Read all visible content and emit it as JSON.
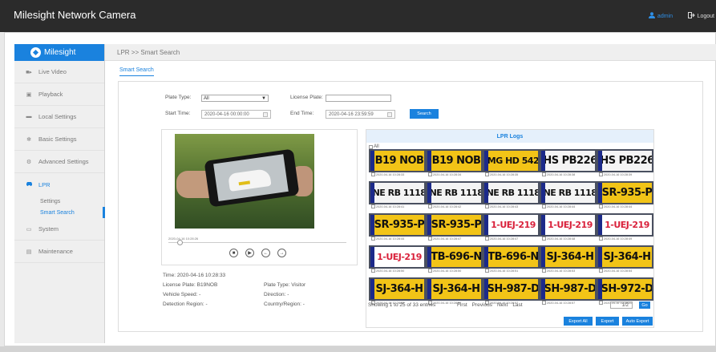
{
  "header": {
    "title": "Milesight Network Camera",
    "user": "admin",
    "logout": "Logout"
  },
  "sidebar": {
    "brand": "Milesight",
    "items": [
      {
        "label": "Live Video",
        "icon": "video-camera-icon"
      },
      {
        "label": "Playback",
        "icon": "playback-icon"
      },
      {
        "label": "Local Settings",
        "icon": "folder-icon"
      },
      {
        "label": "Basic Settings",
        "icon": "gear-icon"
      },
      {
        "label": "Advanced Settings",
        "icon": "advanced-gears-icon"
      },
      {
        "label": "LPR",
        "icon": "car-icon"
      },
      {
        "label": "System",
        "icon": "monitor-icon"
      },
      {
        "label": "Maintenance",
        "icon": "toolbox-icon"
      }
    ],
    "lpr_sub": [
      "Settings",
      "Smart Search"
    ]
  },
  "breadcrumb": "LPR >> Smart Search",
  "tab": "Smart Search",
  "search": {
    "plate_type_label": "Plate Type:",
    "plate_type_value": "All",
    "license_plate_label": "License Plate:",
    "license_plate_value": "",
    "start_time_label": "Start Time:",
    "start_time_value": "2020-04-16 00:00:00",
    "end_time_label": "End Time:",
    "end_time_value": "2020-04-16 23:59:59",
    "search_button": "Search"
  },
  "player": {
    "timestamp": "2020-04-16 10:28:26"
  },
  "details": {
    "time": "Time: 2020-04-16 10:28:33",
    "license_plate": "License Plate: B19NOB",
    "plate_type": "Plate Type: Visitor",
    "vehicle_speed": "Vehicle Speed: -",
    "direction": "Direction: -",
    "detection_region": "Detection Region: -",
    "country_region": "Country/Region: -"
  },
  "logs": {
    "title": "LPR Logs",
    "all_label": "All",
    "entries": [
      {
        "plate": "B19 NOB",
        "time": "2020-04-16 10:28:33",
        "style": "yellow"
      },
      {
        "plate": "B19 NOB",
        "time": "2020-04-16 10:28:34",
        "style": "yellow"
      },
      {
        "plate": "MG HD 542",
        "time": "2020-04-16 10:28:35",
        "style": "yellow"
      },
      {
        "plate": "HS PB226",
        "time": "2020-04-16 10:28:38",
        "style": "white"
      },
      {
        "plate": "HS PB226",
        "time": "2020-04-16 10:28:39",
        "style": "white"
      },
      {
        "plate": "NE RB 1118",
        "time": "2020-04-16 10:28:41",
        "style": "white"
      },
      {
        "plate": "NE RB 1118",
        "time": "2020-04-16 10:28:42",
        "style": "white"
      },
      {
        "plate": "NE RB 1118",
        "time": "2020-04-16 10:28:43",
        "style": "white"
      },
      {
        "plate": "NE RB 1118",
        "time": "2020-04-16 10:28:44",
        "style": "white"
      },
      {
        "plate": "SR-935-P",
        "time": "2020-04-16 10:28:44",
        "style": "yellow"
      },
      {
        "plate": "SR-935-P",
        "time": "2020-04-16 10:28:44",
        "style": "yellow"
      },
      {
        "plate": "SR-935-P",
        "time": "2020-04-16 10:28:47",
        "style": "yellow"
      },
      {
        "plate": "1-UEJ-219",
        "time": "2020-04-16 10:28:47",
        "style": "red"
      },
      {
        "plate": "1-UEJ-219",
        "time": "2020-04-16 10:28:48",
        "style": "red"
      },
      {
        "plate": "1-UEJ-219",
        "time": "2020-04-16 10:28:49",
        "style": "red"
      },
      {
        "plate": "1-UEJ-219",
        "time": "2020-04-16 10:28:50",
        "style": "red"
      },
      {
        "plate": "TB-696-N",
        "time": "2020-04-16 10:28:50",
        "style": "yellow"
      },
      {
        "plate": "TB-696-N",
        "time": "2020-04-16 10:28:51",
        "style": "yellow"
      },
      {
        "plate": "SJ-364-H",
        "time": "2020-04-16 10:28:53",
        "style": "yellow"
      },
      {
        "plate": "SJ-364-H",
        "time": "2020-04-16 10:28:54",
        "style": "yellow"
      },
      {
        "plate": "SJ-364-H",
        "time": "2020-04-16 10:28:55",
        "style": "yellow"
      },
      {
        "plate": "SJ-364-H",
        "time": "2020-04-16 10:28:56",
        "style": "yellow"
      },
      {
        "plate": "SH-987-D",
        "time": "2020-04-16 10:28:57",
        "style": "yellow"
      },
      {
        "plate": "SH-987-D",
        "time": "2020-04-16 10:28:57",
        "style": "yellow"
      },
      {
        "plate": "SH-972-D",
        "time": "2020-04-16 10:29:00",
        "style": "yellow"
      }
    ]
  },
  "pagination": {
    "entries": "Showing 1 to 25 of 33 entries",
    "first": "First",
    "previous": "Previous",
    "next": "Next",
    "last": "Last",
    "page": "1/2",
    "go": "Go"
  },
  "export": {
    "export_all": "Export All",
    "export": "Export",
    "auto_export": "Auto Export"
  },
  "colors": {
    "accent": "#1a82de",
    "topbar": "#2b2b2b",
    "plate_yellow": "#f2c417",
    "plate_red": "#d9213b"
  }
}
